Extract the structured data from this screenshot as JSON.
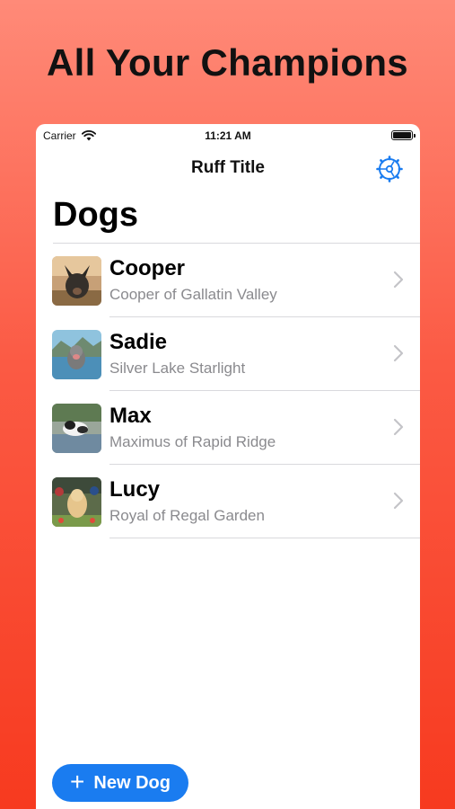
{
  "headline": "All Your Champions",
  "status_bar": {
    "carrier": "Carrier",
    "time": "11:21 AM"
  },
  "nav": {
    "title": "Ruff Title",
    "settings_icon": "gear-icon"
  },
  "list_title": "Dogs",
  "dogs": [
    {
      "name": "Cooper",
      "subtitle": "Cooper of Gallatin Valley"
    },
    {
      "name": "Sadie",
      "subtitle": "Silver Lake Starlight"
    },
    {
      "name": "Max",
      "subtitle": "Maximus of Rapid Ridge"
    },
    {
      "name": "Lucy",
      "subtitle": "Royal of Regal Garden"
    }
  ],
  "fab": {
    "label": "New Dog",
    "icon": "plus-icon"
  },
  "colors": {
    "accent": "#1a7cf0",
    "background_top": "#ff8a78",
    "background_bottom": "#f73a1f"
  }
}
